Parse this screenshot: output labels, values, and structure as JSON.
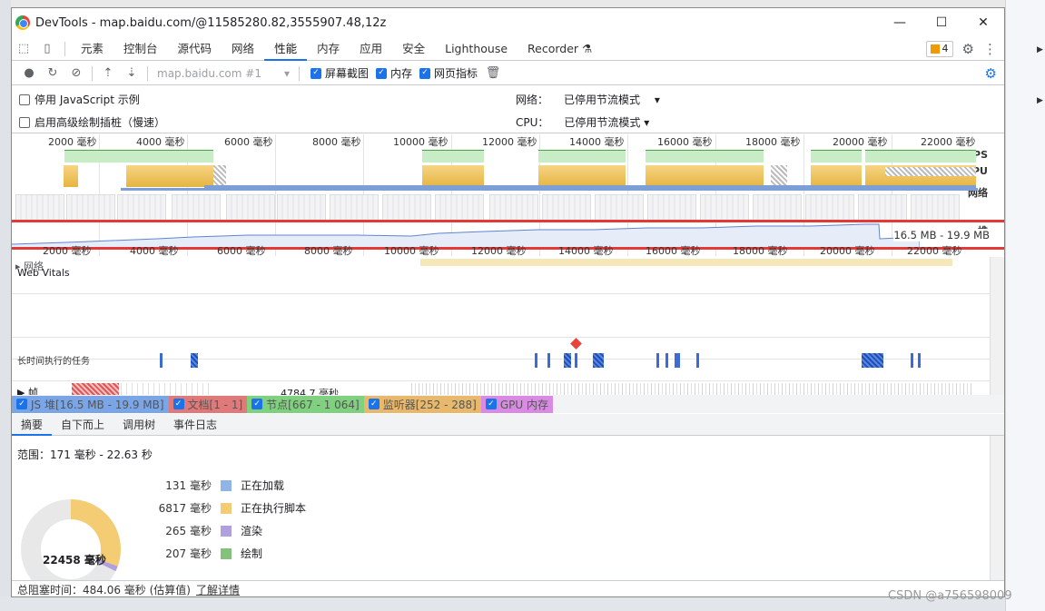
{
  "window": {
    "title": "DevTools - map.baidu.com/@11585280.82,3555907.48,12z"
  },
  "tabs": [
    "元素",
    "控制台",
    "源代码",
    "网络",
    "性能",
    "内存",
    "应用",
    "安全",
    "Lighthouse",
    "Recorder"
  ],
  "active_tab": "性能",
  "issues_count": "4",
  "toolbar": {
    "profile_select": "map.baidu.com #1",
    "screenshot_label": "屏幕截图",
    "memory_label": "内存",
    "webvitals_label": "网页指标"
  },
  "settings": {
    "disable_js_samples": "停用 JavaScript 示例",
    "enable_paint_instrumentation": "启用高级绘制插桩（慢速）",
    "network_label": "网络：",
    "network_value": "已停用节流模式",
    "cpu_label": "CPU：",
    "cpu_value": "已停用节流模式"
  },
  "overview": {
    "ticks": [
      "2000 毫秒",
      "4000 毫秒",
      "6000 毫秒",
      "8000 毫秒",
      "10000 毫秒",
      "12000 毫秒",
      "14000 毫秒",
      "16000 毫秒",
      "18000 毫秒",
      "20000 毫秒",
      "22000 毫秒"
    ],
    "fps_label": "FPS",
    "cpu_label": "CPU",
    "net_label": "网络",
    "heap_label": "堆",
    "heap_range": "16.5 MB - 19.9 MB"
  },
  "timeline": {
    "ticks": [
      "2000 毫秒",
      "4000 毫秒",
      "6000 毫秒",
      "8000 毫秒",
      "10000 毫秒",
      "12000 毫秒",
      "14000 毫秒",
      "16000 毫秒",
      "18000 毫秒",
      "20000 毫秒",
      "22000 毫秒"
    ],
    "network_row": "网络",
    "web_vitals": "Web Vitals",
    "long_tasks": "长时间执行的任务",
    "frames": "帧",
    "frame_time": "4784.7 毫秒"
  },
  "legend": [
    {
      "label": "JS 堆[16.5 MB - 19.9 MB]",
      "color": "#7aa6e8"
    },
    {
      "label": "文档[1 - 1]",
      "color": "#e07a7a"
    },
    {
      "label": "节点[667 - 1 064]",
      "color": "#7fd07f"
    },
    {
      "label": "监听器[252 - 288]",
      "color": "#e8b86c"
    },
    {
      "label": "GPU 内存",
      "color": "#d98be3"
    }
  ],
  "subtabs": [
    "摘要",
    "自下而上",
    "调用树",
    "事件日志"
  ],
  "summary": {
    "range": "范围：171 毫秒 - 22.63 秒",
    "total": "22458 毫秒",
    "items": [
      {
        "value": "131 毫秒",
        "label": "正在加载",
        "color": "#8fb4e8"
      },
      {
        "value": "6817 毫秒",
        "label": "正在执行脚本",
        "color": "#f3cc74"
      },
      {
        "value": "265 毫秒",
        "label": "渲染",
        "color": "#b1a0e0"
      },
      {
        "value": "207 毫秒",
        "label": "绘制",
        "color": "#84c17a"
      }
    ]
  },
  "status": {
    "text": "总阻塞时间：484.06 毫秒 (估算值)",
    "link": "了解详情"
  },
  "watermark": "CSDN @a756598009"
}
